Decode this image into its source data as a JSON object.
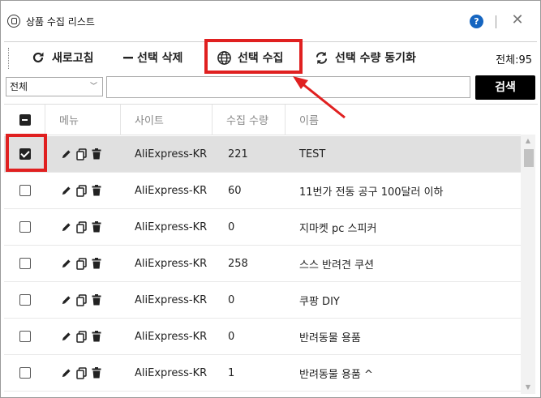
{
  "window": {
    "title": "상품 수집 리스트",
    "help_label": "?",
    "close_label": "✕"
  },
  "toolbar": {
    "refresh_label": "새로고침",
    "delete_label": "선택 삭제",
    "collect_label": "선택 수집",
    "sync_label": "선택 수량 동기화",
    "total_label": "전체:95"
  },
  "search": {
    "filter_value": "전체",
    "query_value": "",
    "button_label": "검색"
  },
  "table": {
    "headers": {
      "menu": "메뉴",
      "site": "사이트",
      "count": "수집 수량",
      "name": "이름"
    },
    "rows": [
      {
        "checked": true,
        "site": "AliExpress-KR",
        "count": "221",
        "name": "TEST"
      },
      {
        "checked": false,
        "site": "AliExpress-KR",
        "count": "60",
        "name": "11번가 전동 공구 100달러 이하"
      },
      {
        "checked": false,
        "site": "AliExpress-KR",
        "count": "0",
        "name": "지마켓 pc 스피커"
      },
      {
        "checked": false,
        "site": "AliExpress-KR",
        "count": "258",
        "name": "스스 반려견 쿠션"
      },
      {
        "checked": false,
        "site": "AliExpress-KR",
        "count": "0",
        "name": "쿠팡 DIY"
      },
      {
        "checked": false,
        "site": "AliExpress-KR",
        "count": "0",
        "name": "반려동물 용품"
      },
      {
        "checked": false,
        "site": "AliExpress-KR",
        "count": "1",
        "name": "반려동물 용품 ^"
      }
    ]
  },
  "colors": {
    "highlight": "#e02020",
    "help_icon": "#1565c0",
    "search_button": "#000000",
    "selected_row": "#e0e0e0"
  },
  "icons": {
    "app": "app-logo-icon",
    "refresh": "refresh-icon",
    "delete": "minus-icon",
    "collect": "globe-icon",
    "sync": "sync-icon",
    "edit": "pencil-icon",
    "copy": "copy-icon",
    "trash": "trash-icon"
  }
}
